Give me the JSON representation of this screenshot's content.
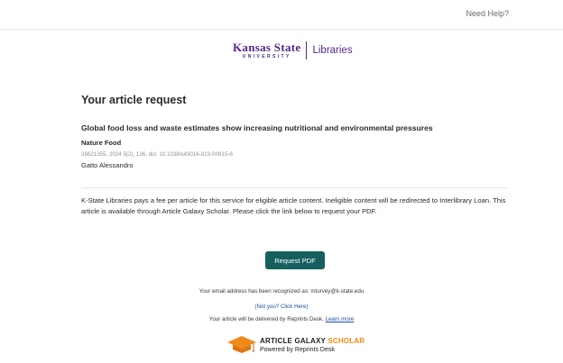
{
  "header": {
    "need_help": "Need Help?"
  },
  "logo": {
    "line1": "Kansas State",
    "line2": "UNIVERSITY",
    "libraries": "Libraries"
  },
  "page": {
    "title": "Your article request"
  },
  "article": {
    "title": "Global food loss and waste estimates show increasing nutritional and environmental pressures",
    "journal": "Nature Food",
    "citation": "26621355, 2024 5(2), 136, doi: 10.1038/s43016-023-00915-6",
    "author": "Gatto Alessandro"
  },
  "notice": "K-State Libraries pays a fee per article for this service for eligible article content.  Ineligible content will be redirected to Interlibrary Loan.  This article is available through Article Galaxy Scholar. Please click the link below to request your PDF.",
  "actions": {
    "request_label": "Request PDF"
  },
  "recognition": {
    "email_text": "Your email address has been recognized as: mturvey@k-state.edu",
    "not_you": "(Not you? Click Here)",
    "delivered_text": "Your article will be delivered by Reprints Desk.",
    "learn_more": "Learn more"
  },
  "branding": {
    "ag_name_prefix": "ARTICLE GALAXY ",
    "ag_name_suffix": "SCHOLAR",
    "powered_by": "Powered by Reprints Desk",
    "icon": "graduation-cap-icon"
  },
  "colors": {
    "brand_purple": "#512888",
    "button_teal": "#15605e",
    "link_blue": "#1f4fa3",
    "accent_orange": "#f08a1c"
  }
}
